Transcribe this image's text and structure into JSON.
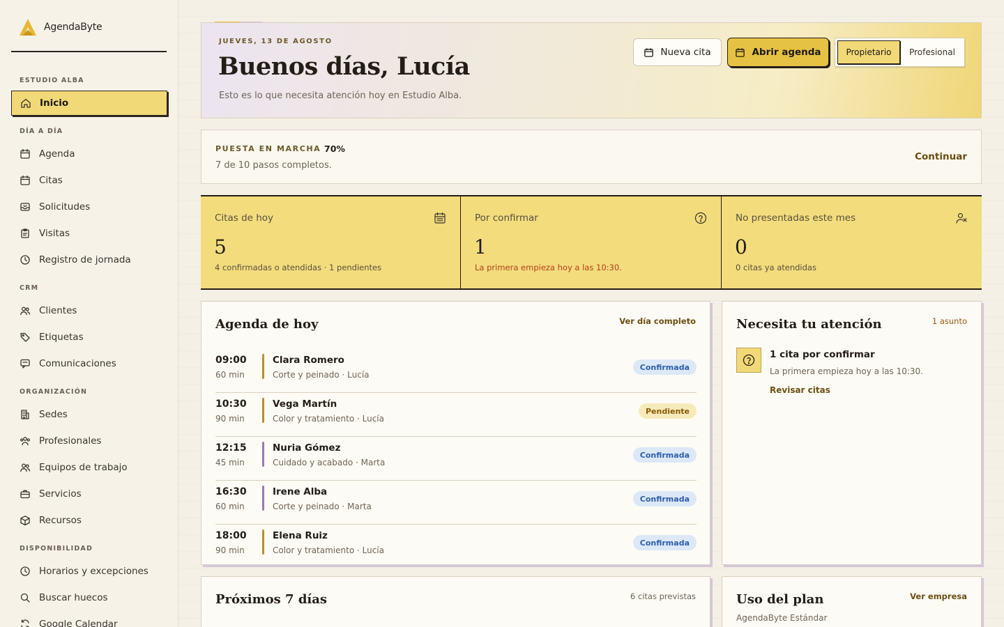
{
  "brand": {
    "name": "AgendaByte"
  },
  "sidebar": {
    "sections": [
      {
        "title": "ESTUDIO ALBA",
        "items": [
          {
            "label": "Inicio",
            "icon": "home-icon",
            "active": true
          }
        ]
      },
      {
        "title": "DÍA A DÍA",
        "items": [
          {
            "label": "Agenda",
            "icon": "calendar-icon"
          },
          {
            "label": "Citas",
            "icon": "calendar-icon"
          },
          {
            "label": "Solicitudes",
            "icon": "inbox-icon"
          },
          {
            "label": "Visitas",
            "icon": "clipboard-icon"
          },
          {
            "label": "Registro de jornada",
            "icon": "clock-icon"
          }
        ]
      },
      {
        "title": "CRM",
        "items": [
          {
            "label": "Clientes",
            "icon": "users-icon"
          },
          {
            "label": "Etiquetas",
            "icon": "tag-icon"
          },
          {
            "label": "Comunicaciones",
            "icon": "message-icon"
          }
        ]
      },
      {
        "title": "ORGANIZACIÓN",
        "items": [
          {
            "label": "Sedes",
            "icon": "building-icon"
          },
          {
            "label": "Profesionales",
            "icon": "team-icon"
          },
          {
            "label": "Equipos de trabajo",
            "icon": "users-icon"
          },
          {
            "label": "Servicios",
            "icon": "briefcase-icon"
          },
          {
            "label": "Recursos",
            "icon": "box-icon"
          }
        ]
      },
      {
        "title": "DISPONIBILIDAD",
        "items": [
          {
            "label": "Horarios y excepciones",
            "icon": "clock-icon"
          },
          {
            "label": "Buscar huecos",
            "icon": "search-icon"
          },
          {
            "label": "Google Calendar",
            "icon": "sync-icon"
          }
        ]
      }
    ]
  },
  "hero": {
    "date": "JUEVES, 13 DE AGOSTO",
    "title": "Buenos días, Lucía",
    "subtitle": "Esto es lo que necesita atención hoy en Estudio Alba.",
    "new_appointment": "Nueva cita",
    "open_agenda": "Abrir agenda",
    "roles": [
      "Propietario",
      "Profesional"
    ]
  },
  "setup": {
    "label": "PUESTA EN MARCHA",
    "percent": "70%",
    "progress": 0.7,
    "steps": "7 de 10 pasos completos.",
    "continue": "Continuar"
  },
  "stats": [
    {
      "label": "Citas de hoy",
      "value": "5",
      "note": "4 confirmadas o atendidas · 1 pendientes",
      "icon": "calendar-list-icon",
      "alert": false
    },
    {
      "label": "Por confirmar",
      "value": "1",
      "note": "La primera empieza hoy a las 10:30.",
      "icon": "help-circle-icon",
      "alert": true
    },
    {
      "label": "No presentadas este mes",
      "value": "0",
      "note": "0 citas ya atendidas",
      "icon": "user-x-icon",
      "alert": false
    }
  ],
  "today": {
    "title": "Agenda de hoy",
    "link": "Ver día completo",
    "appointments": [
      {
        "time": "09:00",
        "duration": "60 min",
        "client": "Clara Romero",
        "service": "Corte y peinado · Lucía",
        "status": "Confirmada",
        "status_kind": "ok",
        "color": "#b8902a"
      },
      {
        "time": "10:30",
        "duration": "90 min",
        "client": "Vega Martín",
        "service": "Color y tratamiento · Lucía",
        "status": "Pendiente",
        "status_kind": "pending",
        "color": "#b8902a"
      },
      {
        "time": "12:15",
        "duration": "45 min",
        "client": "Nuria Gómez",
        "service": "Cuidado y acabado · Marta",
        "status": "Confirmada",
        "status_kind": "ok",
        "color": "#9b7ab0"
      },
      {
        "time": "16:30",
        "duration": "60 min",
        "client": "Irene Alba",
        "service": "Corte y peinado · Marta",
        "status": "Confirmada",
        "status_kind": "ok",
        "color": "#9b7ab0"
      },
      {
        "time": "18:00",
        "duration": "90 min",
        "client": "Elena Ruiz",
        "service": "Color y tratamiento · Lucía",
        "status": "Confirmada",
        "status_kind": "ok",
        "color": "#b8902a"
      }
    ]
  },
  "attention": {
    "title": "Necesita tu atención",
    "count": "1 asunto",
    "item_title": "1 cita por confirmar",
    "item_sub": "La primera empieza hoy a las 10:30.",
    "item_link": "Revisar citas"
  },
  "upcoming": {
    "title": "Próximos 7 días",
    "count": "6 citas previstas"
  },
  "plan": {
    "title": "Uso del plan",
    "link": "Ver empresa",
    "plan_name": "AgendaByte Estándar"
  },
  "colors": {
    "accent": "#f2d977",
    "accent_strong": "#e6c244",
    "ink": "#231d17",
    "confirmed": "#2e5da8",
    "alert": "#b0401a"
  }
}
